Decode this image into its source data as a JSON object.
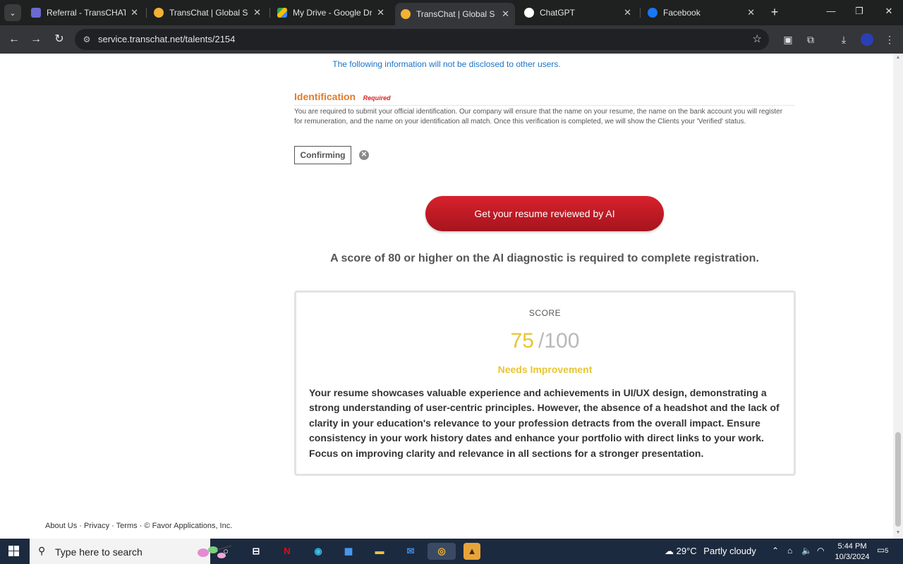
{
  "browser": {
    "tabs": [
      {
        "title": "Referral - TransCHAT ins",
        "favicon_color": "#6a6ad0"
      },
      {
        "title": "TransChat | Global Soun",
        "favicon_color": "#f2b233"
      },
      {
        "title": "My Drive - Google Drive",
        "favicon_color": "#2da44e"
      },
      {
        "title": "TransChat | Global Soun",
        "favicon_color": "#f2b233"
      },
      {
        "title": "ChatGPT",
        "favicon_color": "#ffffff"
      },
      {
        "title": "Facebook",
        "favicon_color": "#1877f2"
      }
    ],
    "active_tab_index": 3,
    "url": "service.transchat.net/talents/2154"
  },
  "page": {
    "disclose_note": "The following information will not be disclosed to other users.",
    "identification": {
      "title": "Identification",
      "required_tag": "Required",
      "description": "You are required to submit your official identification. Our company will ensure that the name on your resume, the name on the bank account you will register for remuneration, and the name on your identification all match. Once this verification is completed, we will show the Clients your 'Verified' status.",
      "status_button": "Confirming"
    },
    "ai_button": "Get your resume reviewed by AI",
    "score_requirement": "A score of 80 or higher on the AI diagnostic is required to complete registration.",
    "score": {
      "label": "SCORE",
      "value": "75",
      "max": "/100",
      "status": "Needs Improvement",
      "status_color": "#e8c530",
      "feedback": "Your resume showcases valuable experience and achievements in UI/UX design, demonstrating a strong understanding of user-centric principles. However, the absence of a headshot and the lack of clarity in your education's relevance to your profession detracts from the overall impact. Ensure consistency in your work history dates and enhance your portfolio with direct links to your work. Focus on improving clarity and relevance in all sections for a stronger presentation."
    },
    "footer": {
      "about": "About Us",
      "privacy": "Privacy",
      "terms": "Terms",
      "copyright": "© Favor Applications, Inc."
    }
  },
  "taskbar": {
    "search_placeholder": "Type here to search",
    "weather_temp": "29°C",
    "weather_desc": "Partly cloudy",
    "time": "5:44 PM",
    "date": "10/3/2024",
    "notification_count": "5"
  }
}
